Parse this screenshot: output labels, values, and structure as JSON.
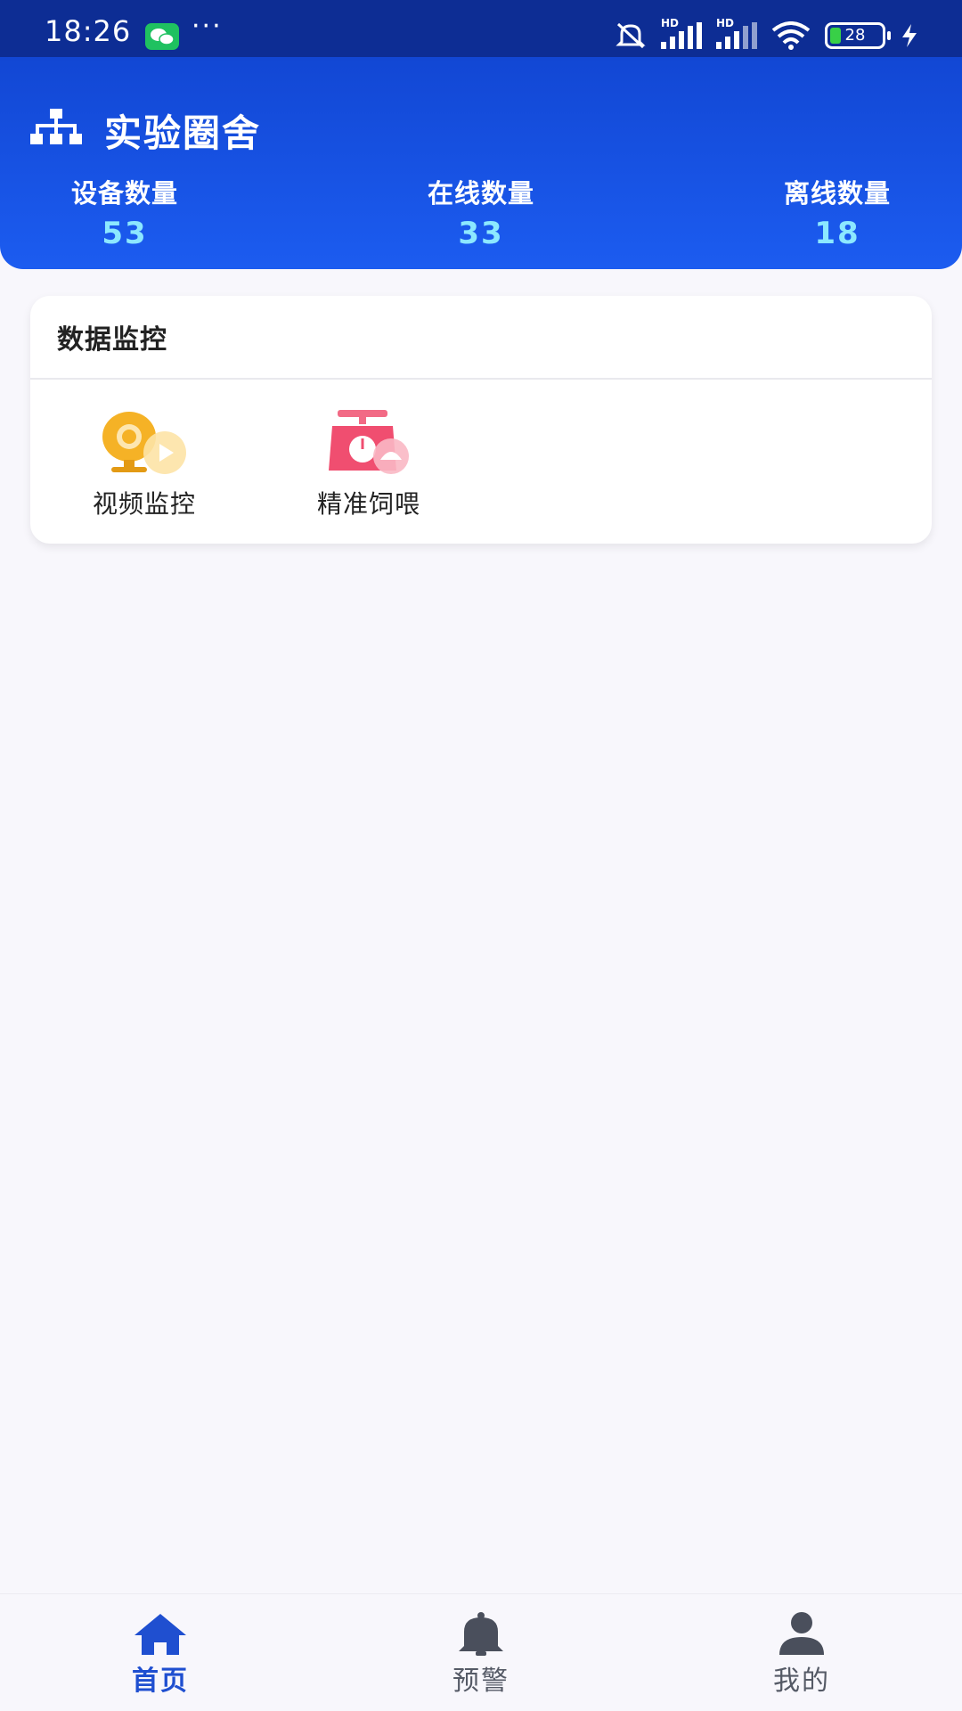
{
  "status_bar": {
    "time": "18:26",
    "more": "···",
    "hd_label": "HD",
    "battery": "28",
    "icons": [
      "wechat-icon",
      "mute-icon",
      "signal-icon",
      "signal-icon",
      "wifi-icon",
      "battery-icon",
      "charging-icon"
    ]
  },
  "header": {
    "title": "实验圈舍",
    "icon": "network-icon",
    "stats": [
      {
        "label": "设备数量",
        "value": "53"
      },
      {
        "label": "在线数量",
        "value": "33"
      },
      {
        "label": "离线数量",
        "value": "18"
      }
    ]
  },
  "monitor": {
    "title": "数据监控",
    "items": [
      {
        "label": "视频监控",
        "icon": "camera-icon"
      },
      {
        "label": "精准饲喂",
        "icon": "scale-icon"
      }
    ]
  },
  "nav": {
    "items": [
      {
        "label": "首页",
        "icon": "home-icon",
        "active": true
      },
      {
        "label": "预警",
        "icon": "bell-icon",
        "active": false
      },
      {
        "label": "我的",
        "icon": "user-icon",
        "active": false
      }
    ]
  },
  "colors": {
    "header_top": "#1247d4",
    "header_bottom": "#1c5cf0",
    "stat_value": "#8ce8ff",
    "active_nav": "#1f4fd0",
    "background": "#f8f7fc"
  }
}
